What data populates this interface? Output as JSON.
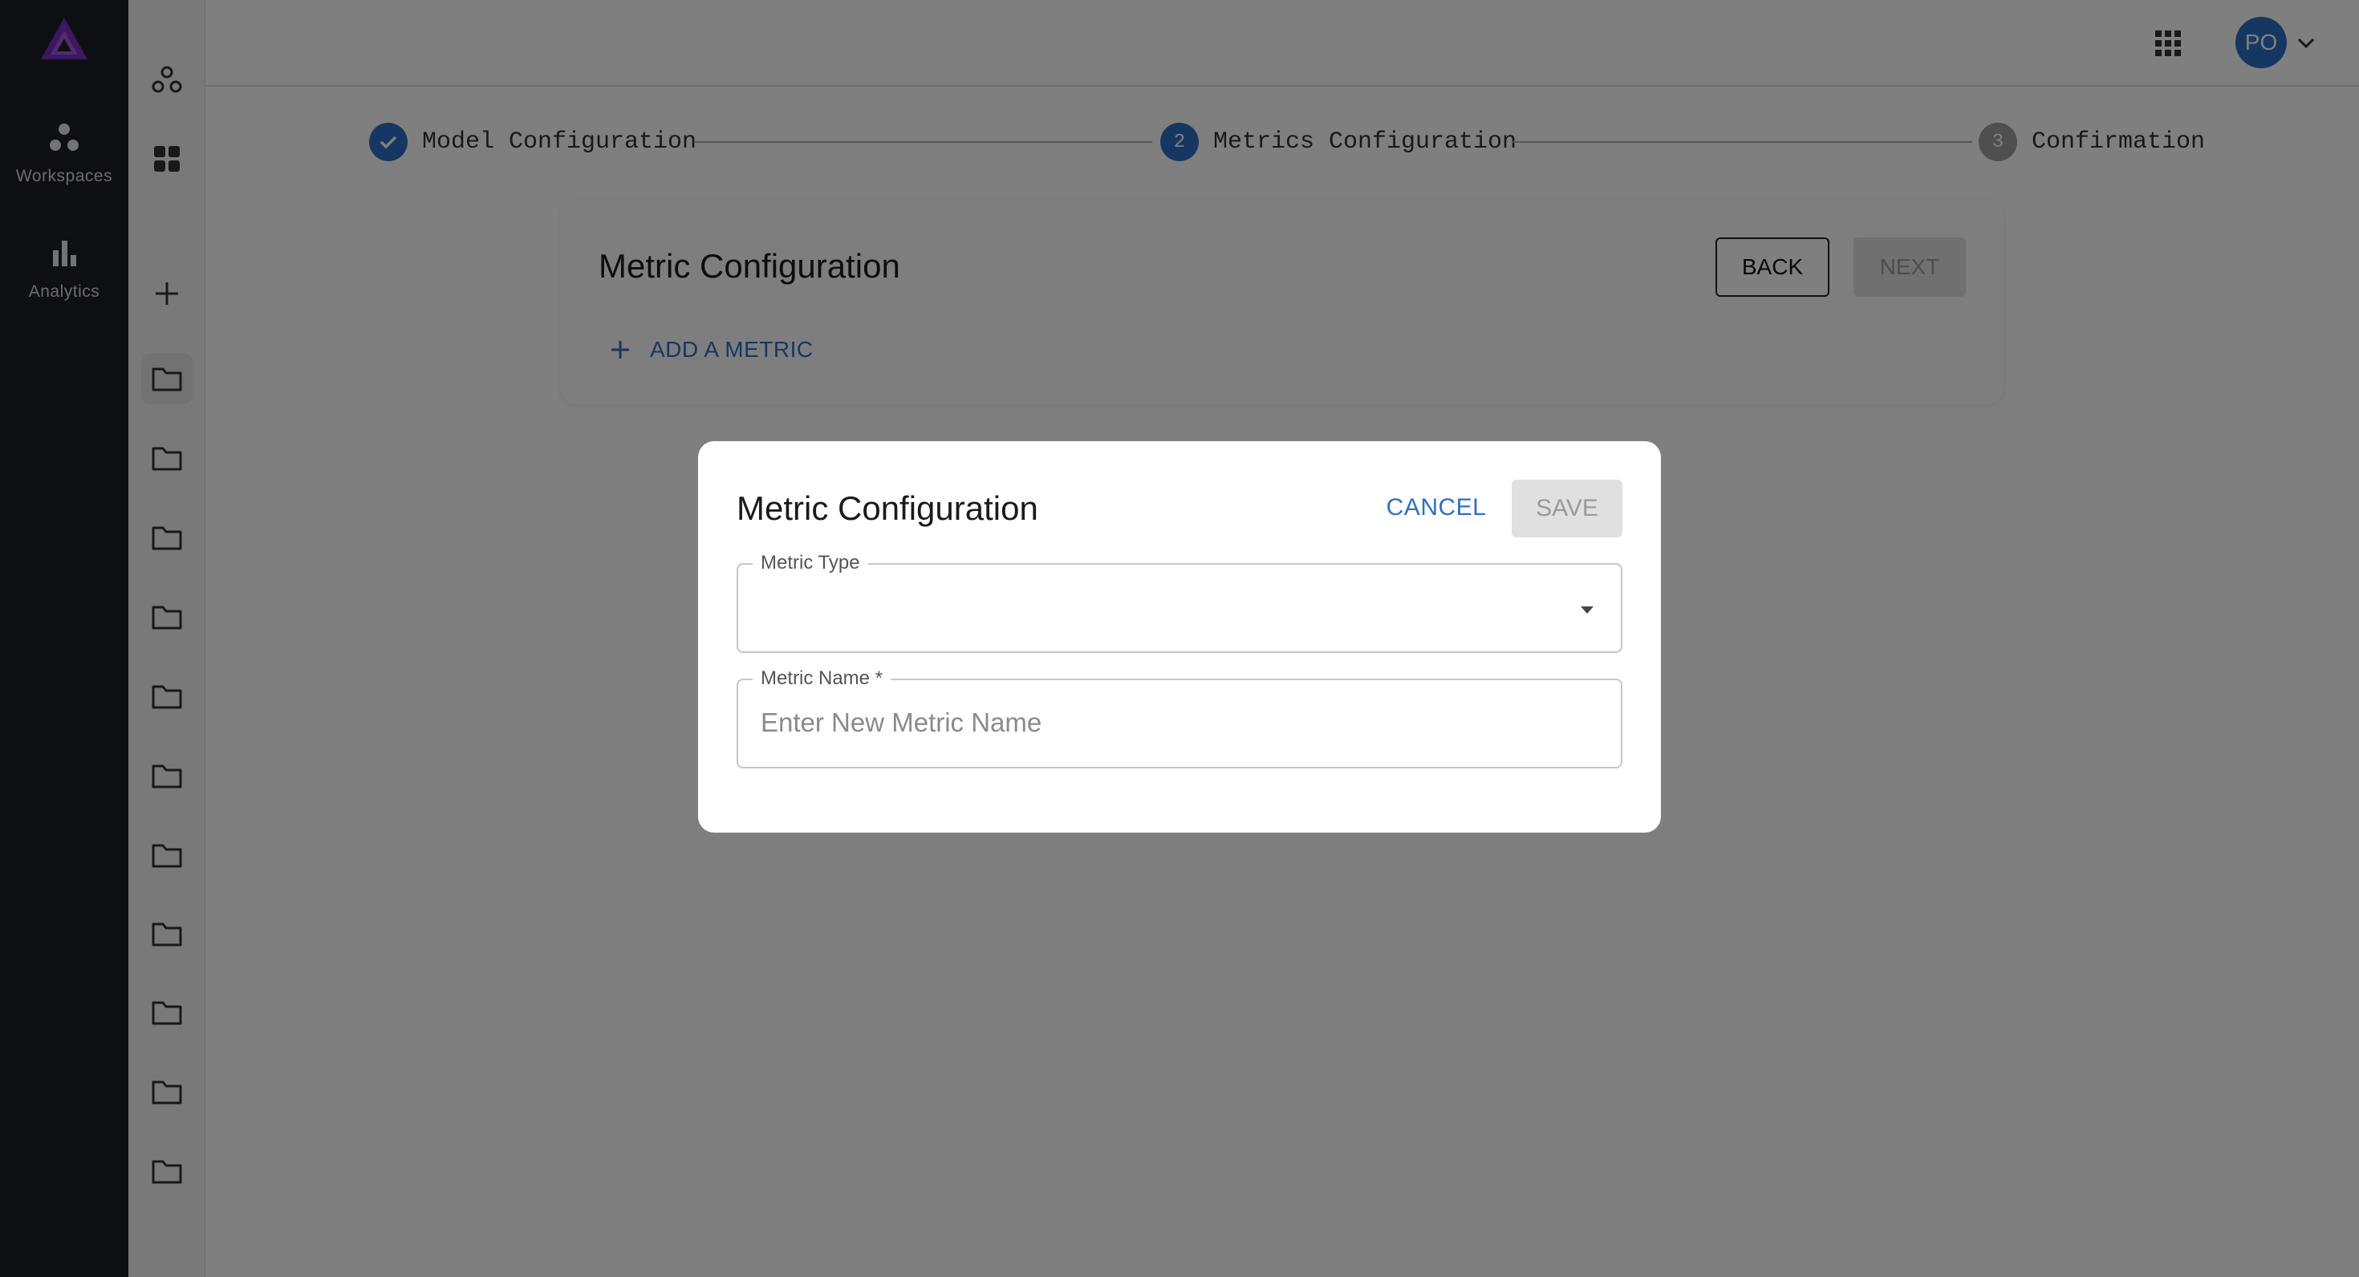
{
  "nav": {
    "items": [
      {
        "label": "Workspaces",
        "icon": "workspaces-icon"
      },
      {
        "label": "Analytics",
        "icon": "analytics-icon"
      }
    ]
  },
  "header": {
    "user_initials": "PO"
  },
  "stepper": {
    "steps": [
      {
        "label": "Model Configuration",
        "marker": "",
        "state": "complete"
      },
      {
        "label": "Metrics Configuration",
        "marker": "2",
        "state": "active"
      },
      {
        "label": "Confirmation",
        "marker": "3",
        "state": "pending"
      }
    ]
  },
  "card": {
    "title": "Metric Configuration",
    "back_label": "BACK",
    "next_label": "NEXT",
    "add_metric_label": "ADD A METRIC"
  },
  "dialog": {
    "title": "Metric Configuration",
    "cancel_label": "CANCEL",
    "save_label": "SAVE",
    "metric_type": {
      "label": "Metric Type",
      "value": ""
    },
    "metric_name": {
      "label": "Metric Name *",
      "placeholder": "Enter New Metric Name",
      "value": ""
    }
  },
  "colors": {
    "accent": "#2f6fc6",
    "brand": "#7b2fbf",
    "rail": "#1d1f24"
  }
}
